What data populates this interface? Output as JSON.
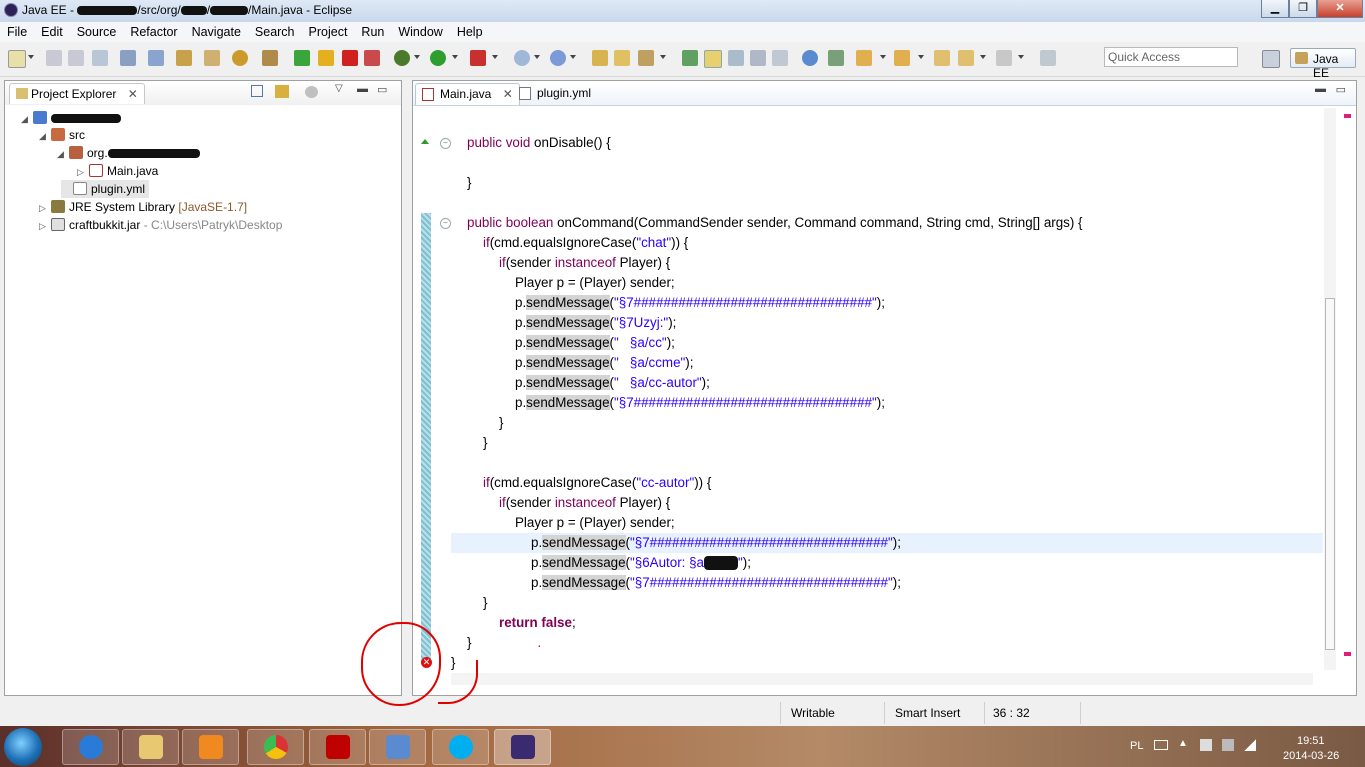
{
  "window": {
    "title_prefix": "Java EE - ",
    "title_mid": "/src/org/",
    "title_suffix": "/Main.java - Eclipse",
    "minimize": "▁",
    "maximize": "❐",
    "close": "✕"
  },
  "menu": [
    "File",
    "Edit",
    "Source",
    "Refactor",
    "Navigate",
    "Search",
    "Project",
    "Run",
    "Window",
    "Help"
  ],
  "toolbar": {
    "quick_access_placeholder": "Quick Access",
    "perspective": "Java EE"
  },
  "explorer": {
    "title": "Project Explorer",
    "items": {
      "src": "src",
      "org": "org.",
      "main": "Main.java",
      "plugin": "plugin.yml",
      "jre": "JRE System Library",
      "jre_ver": "[JavaSE-1.7]",
      "jar": "craftbukkit.jar",
      "jar_path": "- C:\\Users\\Patryk\\Desktop"
    }
  },
  "editor": {
    "tabs": [
      "Main.java",
      "plugin.yml"
    ],
    "lines": {
      "l1_kw": "public void ",
      "l1_rest": "onDisable() {",
      "l2": "}",
      "l3_kw": "public boolean ",
      "l3_rest": "onCommand(CommandSender sender, Command command, String cmd, String[] args) {",
      "if": "if",
      "instanceof": "instanceof",
      "l4_a": "(cmd.equalsIgnoreCase(",
      "l4_s": "\"chat\"",
      "l4_b": ")) {",
      "l5_a": "(sender ",
      "l5_b": " Player) {",
      "l6": "Player p = (Player) sender;",
      "p_dot": "p.",
      "send": "sendMessage",
      "open": "(",
      "close": ");",
      "m1": "\"§7################################\"",
      "m2": "\"§7Uzyj:\"",
      "m3": "\"   §a/cc\"",
      "m4": "\"   §a/ccme\"",
      "m5": "\"   §a/cc-autor\"",
      "m6": "\"§7################################\"",
      "cb": "}",
      "l14_s": "\"cc-autor\"",
      "m7": "\"§7################################\"",
      "m8": "\"§6Autor: §a",
      "m8_end": "\"",
      "m9": "\"§7################################\"",
      "ret_kw": "return false",
      "semi": ";",
      "dot": "."
    }
  },
  "status": {
    "writable": "Writable",
    "insert": "Smart Insert",
    "position": "36 : 32"
  },
  "tray": {
    "lang": "PL",
    "time": "19:51",
    "date": "2014-03-26"
  },
  "colors": {
    "keyword": "#7f0055",
    "string": "#2a00ff",
    "annotation": "#e00000"
  }
}
